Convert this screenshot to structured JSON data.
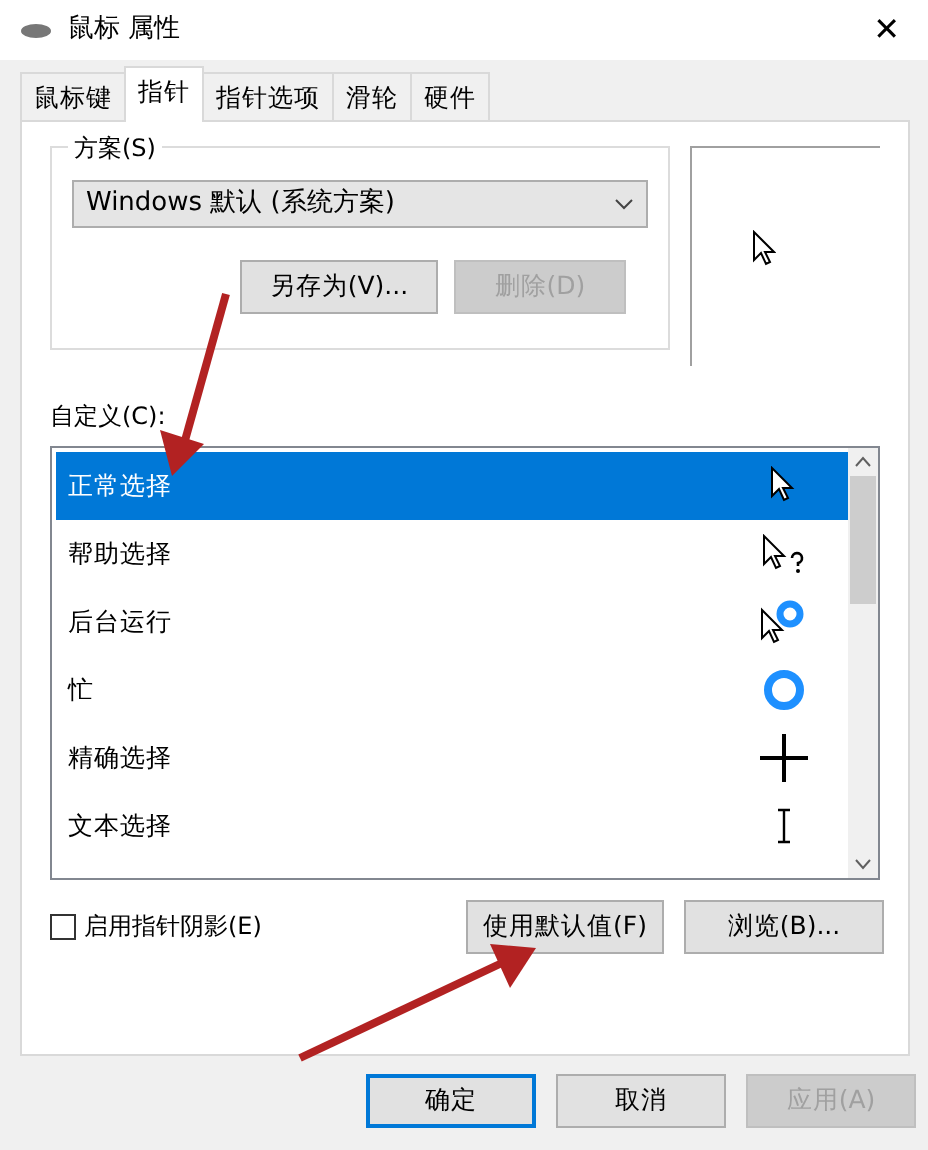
{
  "window": {
    "title": "鼠标 属性",
    "close": "✕"
  },
  "tabs": [
    {
      "label": "鼠标键",
      "selected": false
    },
    {
      "label": "指针",
      "selected": true
    },
    {
      "label": "指针选项",
      "selected": false
    },
    {
      "label": "滑轮",
      "selected": false
    },
    {
      "label": "硬件",
      "selected": false
    }
  ],
  "scheme": {
    "legend": "方案(S)",
    "value": "Windows 默认 (系统方案)",
    "buttons": [
      {
        "label": "另存为(V)...",
        "disabled": false
      },
      {
        "label": "删除(D)",
        "disabled": true
      }
    ]
  },
  "customize": {
    "label": "自定义(C):",
    "rows": [
      {
        "label": "正常选择",
        "selected": true
      },
      {
        "label": "帮助选择",
        "selected": false
      },
      {
        "label": "后台运行",
        "selected": false
      },
      {
        "label": "忙",
        "selected": false
      },
      {
        "label": "精确选择",
        "selected": false
      },
      {
        "label": "文本选择",
        "selected": false
      }
    ]
  },
  "shadow": {
    "label": "启用指针阴影(E)",
    "checked": false
  },
  "panel_buttons": [
    {
      "label": "使用默认值(F)"
    },
    {
      "label": "浏览(B)..."
    }
  ],
  "footer_buttons": [
    {
      "label": "确定",
      "default": true,
      "disabled": false
    },
    {
      "label": "取消",
      "default": false,
      "disabled": false
    },
    {
      "label": "应用(A)",
      "default": false,
      "disabled": true
    }
  ]
}
